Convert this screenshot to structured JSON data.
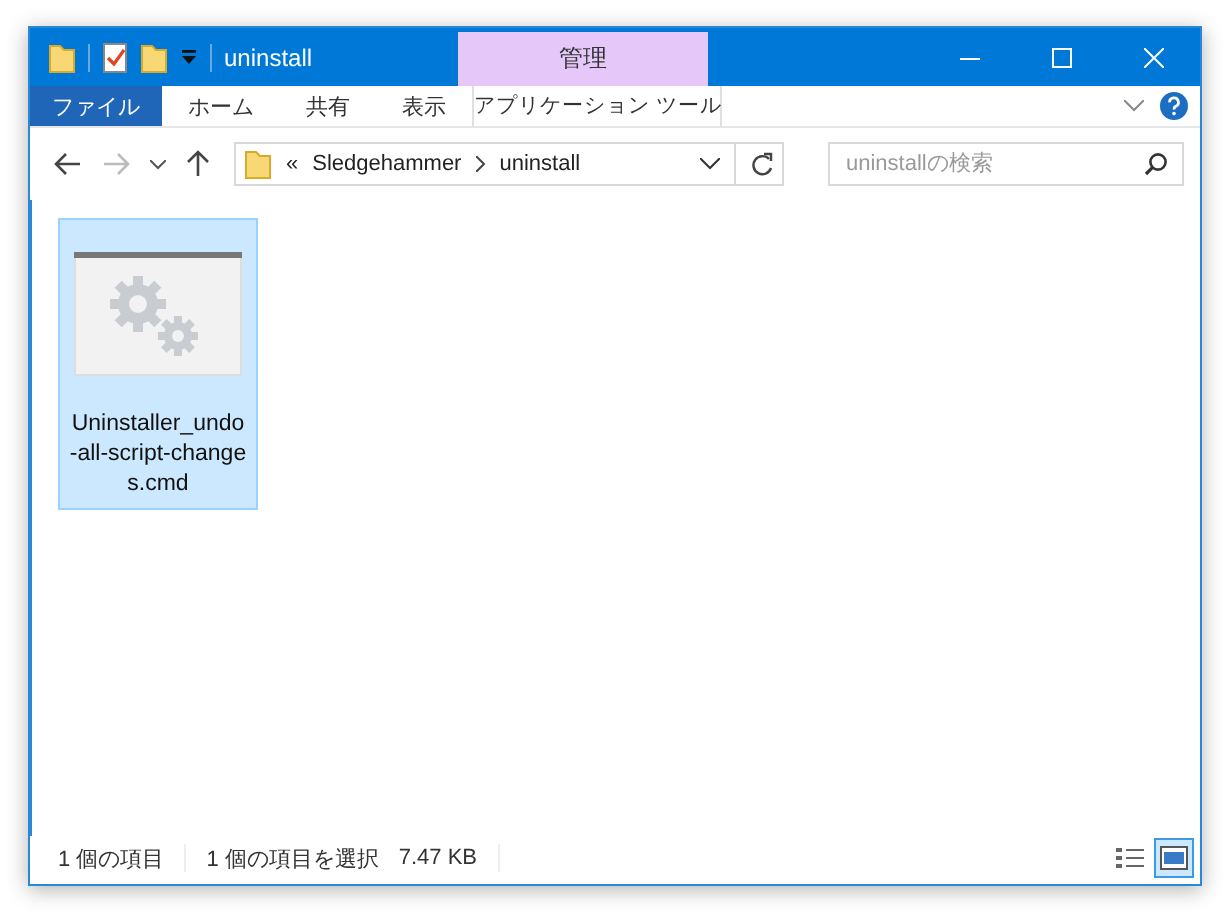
{
  "window": {
    "title": "uninstall"
  },
  "contextual_header": "管理",
  "ribbon_tabs": [
    {
      "label": "ファイル",
      "kind": "file"
    },
    {
      "label": "ホーム",
      "kind": "normal"
    },
    {
      "label": "共有",
      "kind": "normal"
    },
    {
      "label": "表示",
      "kind": "normal"
    },
    {
      "label": "アプリケーション ツール",
      "kind": "contextual"
    }
  ],
  "address": {
    "overflow": "«",
    "path": [
      "Sledgehammer",
      "uninstall"
    ]
  },
  "search": {
    "placeholder": "uninstallの検索"
  },
  "files": [
    {
      "name": "Uninstaller_undo-all-script-changes.cmd",
      "selected": true
    }
  ],
  "status_bar": {
    "count": "1 個の項目",
    "selection": "1 個の項目を選択",
    "size": "7.47 KB"
  },
  "views": [
    {
      "kind": "details",
      "selected": false
    },
    {
      "kind": "large-icons",
      "selected": true
    }
  ]
}
